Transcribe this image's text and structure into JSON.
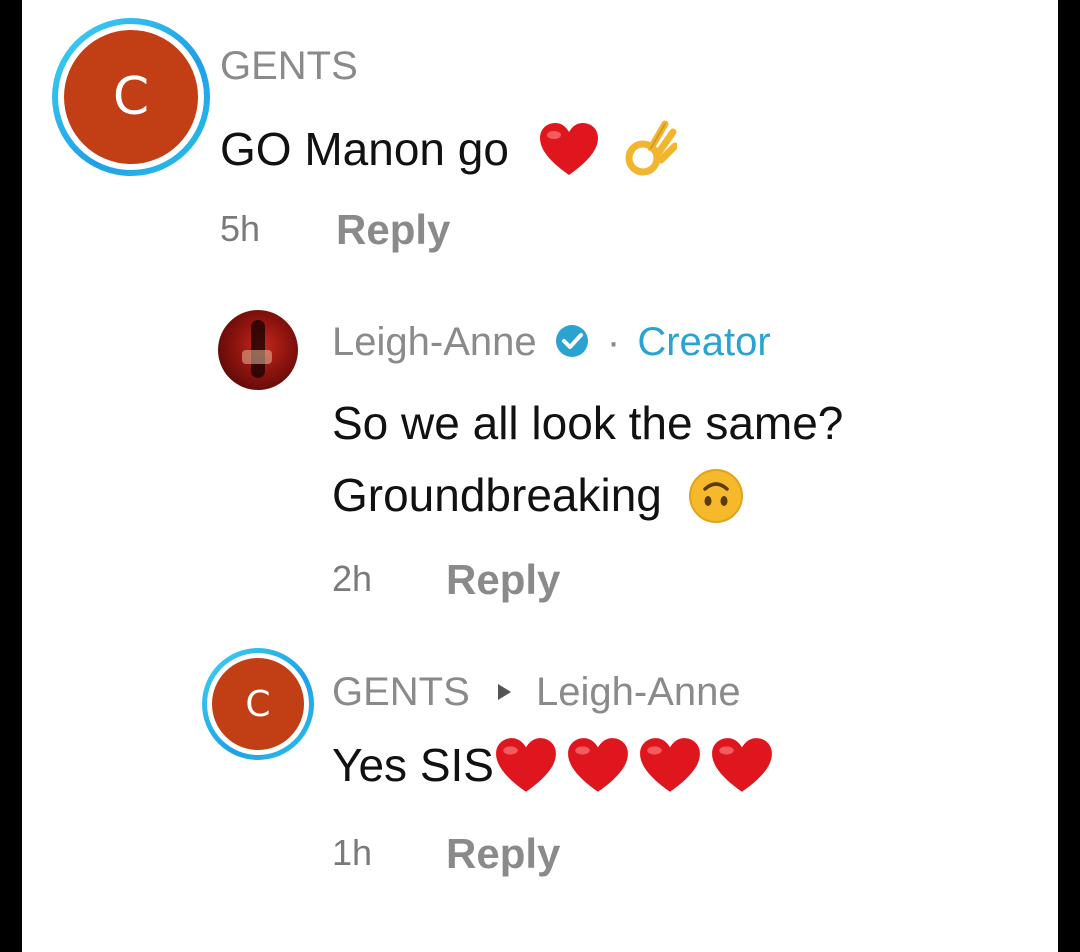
{
  "comments": [
    {
      "avatar_letter": "C",
      "username": "GENTS",
      "text": "GO Manon go",
      "emojis": [
        "red-heart",
        "ok-hand"
      ],
      "time": "5h",
      "reply_label": "Reply"
    },
    {
      "username": "Leigh-Anne",
      "verified": true,
      "separator": "·",
      "badge": "Creator",
      "text_line1": "So we all look the same?",
      "text_line2": "Groundbreaking",
      "emojis": [
        "upside-down-face"
      ],
      "time": "2h",
      "reply_label": "Reply"
    },
    {
      "avatar_letter": "C",
      "username": "GENTS",
      "reply_to": "Leigh-Anne",
      "text": "Yes SIS",
      "emojis": [
        "red-heart",
        "red-heart",
        "red-heart",
        "red-heart"
      ],
      "time": "1h",
      "reply_label": "Reply"
    }
  ],
  "colors": {
    "avatar_bg": "#c23e14",
    "story_ring": "#2bc2e6",
    "creator_blue": "#2ba3d1",
    "muted_text": "#8a8a8a"
  }
}
